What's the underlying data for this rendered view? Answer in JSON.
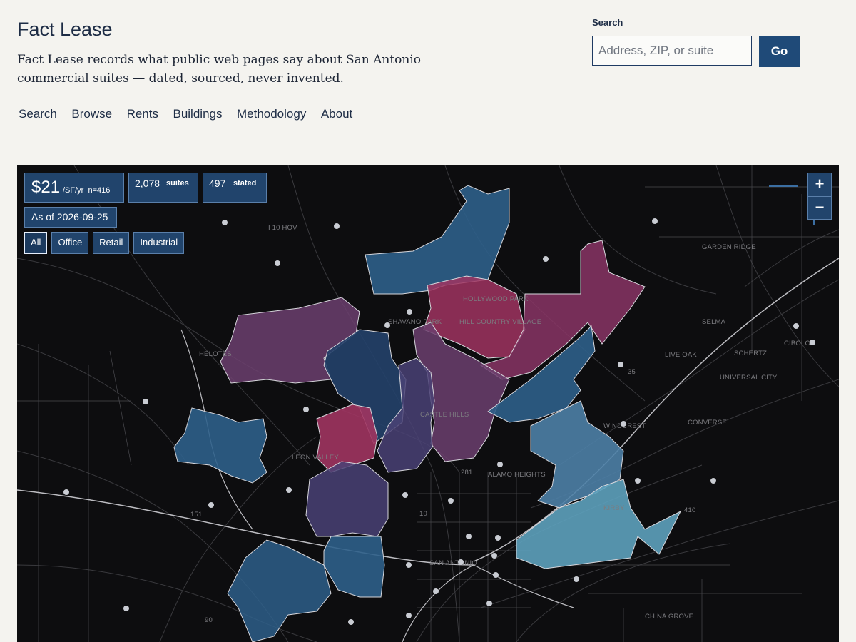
{
  "header": {
    "site_title": "Fact Lease",
    "tagline": "Fact Lease records what public web pages say about San Antonio commercial suites — dated, sourced, never invented.",
    "nav": [
      "Search",
      "Browse",
      "Rents",
      "Buildings",
      "Methodology",
      "About"
    ]
  },
  "search": {
    "label": "Search",
    "placeholder": "Address, ZIP, or suite",
    "button": "Go"
  },
  "map": {
    "stats": {
      "rent_value": "$21",
      "rent_unit": "/SF/yr",
      "rent_n": "n=416",
      "suites_count": "2,078",
      "suites_label": "suites",
      "stated_count": "497",
      "stated_label": "stated",
      "as_of": "As of 2026-09-25"
    },
    "filters": [
      "All",
      "Office",
      "Retail",
      "Industrial"
    ],
    "active_filter": "All",
    "zoom": {
      "in": "+",
      "out": "−"
    },
    "place_labels": [
      "I 10 HOV",
      "HOLLYWOOD PARK",
      "HILL COUNTRY VILLAGE",
      "SHAVANO PARK",
      "GARDEN RIDGE",
      "SELMA",
      "LIVE OAK",
      "SCHERTZ",
      "CIBOLO",
      "UNIVERSAL CITY",
      "HELOTES",
      "CASTLE HILLS",
      "WINDCREST",
      "CONVERSE",
      "LEON VALLEY",
      "ALAMO HEIGHTS",
      "KIRBY",
      "SAN ANTONIO",
      "CHINA GROVE",
      "35",
      "281",
      "10",
      "90",
      "151",
      "410"
    ],
    "colors": {
      "map_background": "#0d0d0f",
      "zone_low": "#5da1bd",
      "zone_mid": "#2e5f8a",
      "zone_dark": "#24416a",
      "zone_purple": "#6c3f6e",
      "zone_high": "#a03460",
      "panel": "#21446c"
    }
  }
}
